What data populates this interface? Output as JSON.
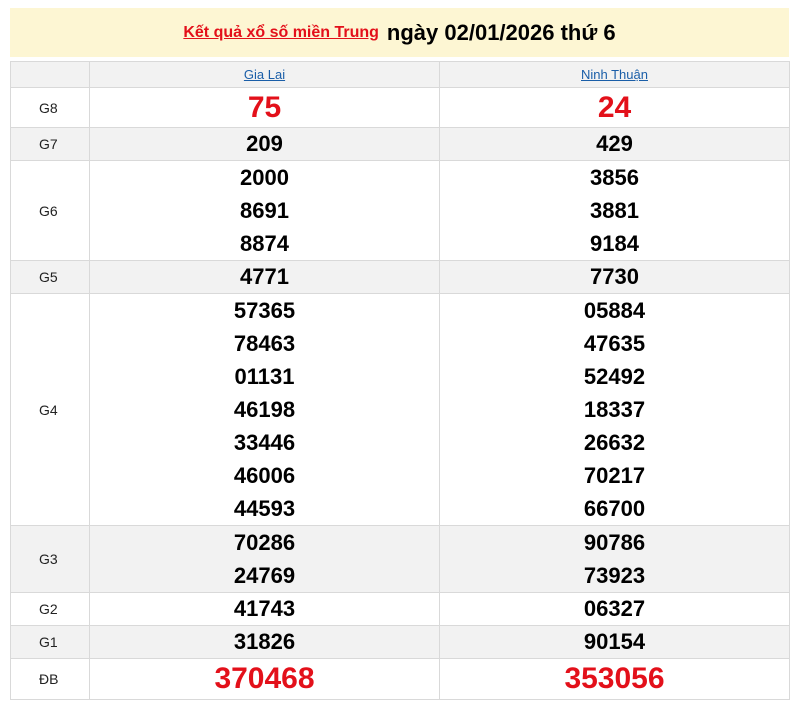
{
  "header": {
    "link_text": "Kết quả xổ số miền Trung",
    "date_text": "ngày 02/01/2026 thứ 6"
  },
  "columns": [
    "Gia Lai",
    "Ninh Thuận"
  ],
  "prizes": [
    {
      "label": "G8",
      "gia_lai": [
        "75"
      ],
      "ninh_thuan": [
        "24"
      ]
    },
    {
      "label": "G7",
      "gia_lai": [
        "209"
      ],
      "ninh_thuan": [
        "429"
      ]
    },
    {
      "label": "G6",
      "gia_lai": [
        "2000",
        "8691",
        "8874"
      ],
      "ninh_thuan": [
        "3856",
        "3881",
        "9184"
      ]
    },
    {
      "label": "G5",
      "gia_lai": [
        "4771"
      ],
      "ninh_thuan": [
        "7730"
      ]
    },
    {
      "label": "G4",
      "gia_lai": [
        "57365",
        "78463",
        "01131",
        "46198",
        "33446",
        "46006",
        "44593"
      ],
      "ninh_thuan": [
        "05884",
        "47635",
        "52492",
        "18337",
        "26632",
        "70217",
        "66700"
      ]
    },
    {
      "label": "G3",
      "gia_lai": [
        "70286",
        "24769"
      ],
      "ninh_thuan": [
        "90786",
        "73923"
      ]
    },
    {
      "label": "G2",
      "gia_lai": [
        "41743"
      ],
      "ninh_thuan": [
        "06327"
      ]
    },
    {
      "label": "G1",
      "gia_lai": [
        "31826"
      ],
      "ninh_thuan": [
        "90154"
      ]
    },
    {
      "label": "ĐB",
      "gia_lai": [
        "370468"
      ],
      "ninh_thuan": [
        "353056"
      ]
    }
  ],
  "colors": {
    "accent_red": "#e3101a",
    "link_blue": "#1a5ea8",
    "header_bg": "#fdf6d3",
    "row_shade": "#f2f2f2"
  }
}
